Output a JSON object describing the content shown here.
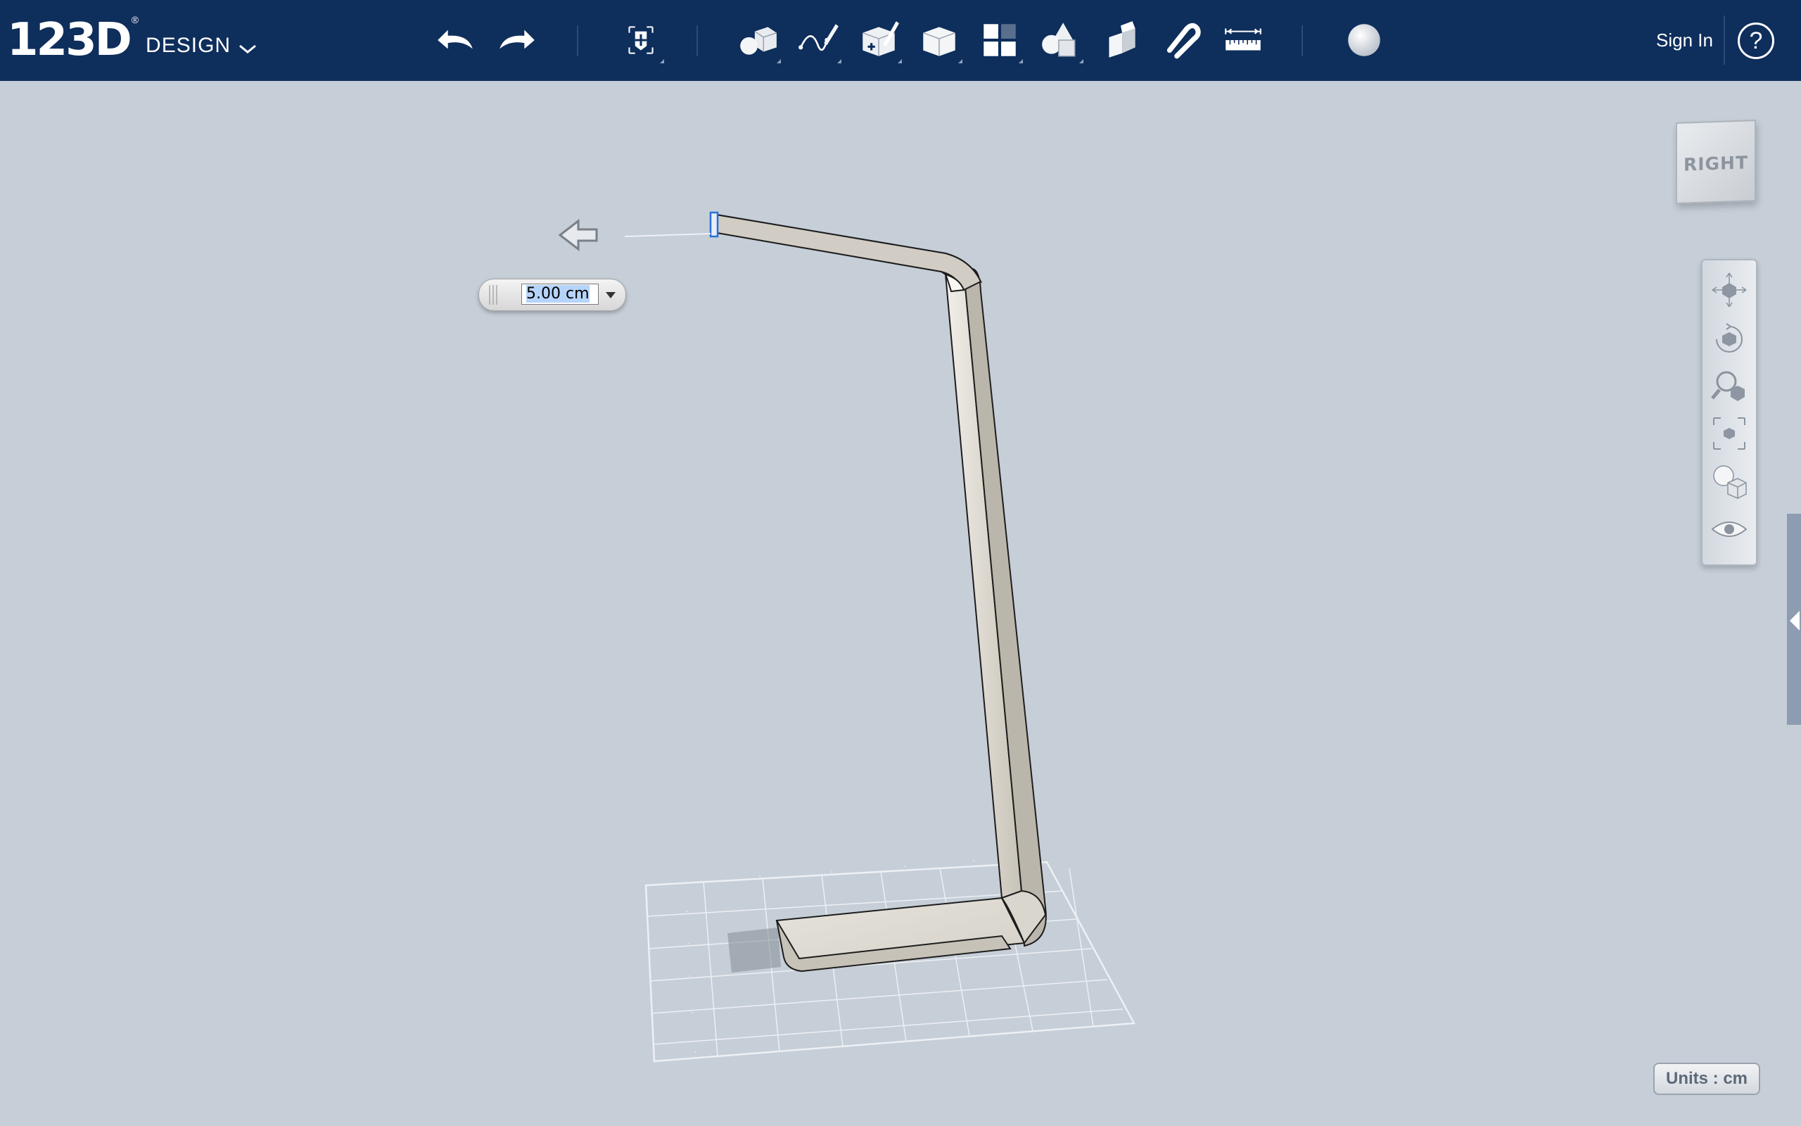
{
  "app": {
    "logo_number": "123D",
    "logo_superscript": "®",
    "logo_product": "DESIGN"
  },
  "toolbar": {
    "buttons": [
      {
        "name": "undo-icon"
      },
      {
        "name": "redo-icon"
      },
      {
        "name": "transform-icon"
      },
      {
        "name": "primitives-icon"
      },
      {
        "name": "sketch-icon"
      },
      {
        "name": "construct-icon"
      },
      {
        "name": "modify-icon"
      },
      {
        "name": "pattern-icon"
      },
      {
        "name": "group-icon"
      },
      {
        "name": "combine-icon"
      },
      {
        "name": "snap-icon"
      },
      {
        "name": "measure-icon"
      },
      {
        "name": "material-icon"
      }
    ],
    "sign_in": "Sign In",
    "help": "?"
  },
  "viewport": {
    "distance_value": "5.00 cm",
    "view_cube_face": "RIGHT",
    "units_label": "Units : cm"
  },
  "nav_panel": [
    {
      "name": "pan-icon"
    },
    {
      "name": "orbit-icon"
    },
    {
      "name": "zoom-icon"
    },
    {
      "name": "fit-icon"
    },
    {
      "name": "view-material-icon"
    },
    {
      "name": "visibility-icon"
    }
  ],
  "colors": {
    "toolbar_bg": "#0e2e5c",
    "canvas_bg": "#c6ced8",
    "selection": "#b6d4fb",
    "model_face": "#dedbd3",
    "model_side": "#b9b4a9"
  }
}
